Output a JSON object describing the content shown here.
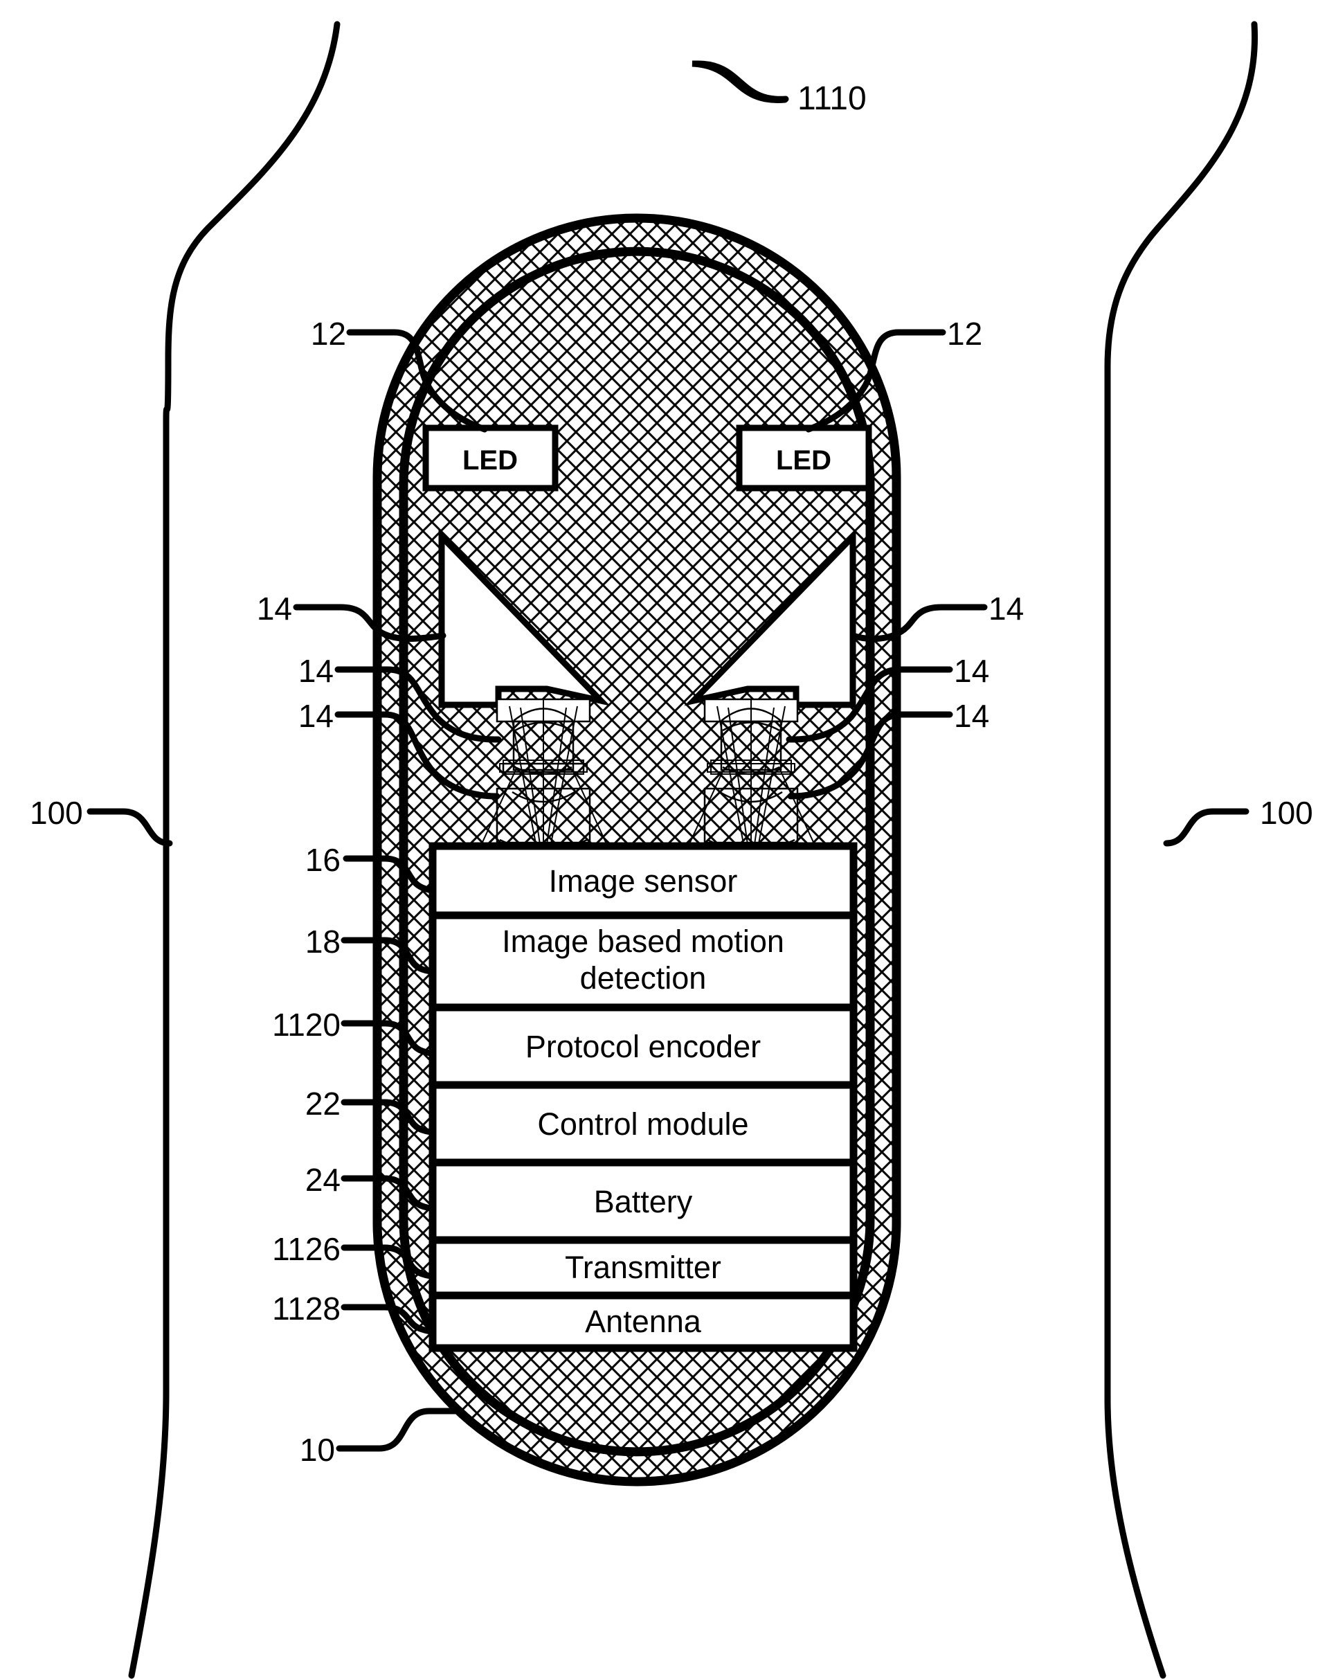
{
  "figure": {
    "kind": "patent-figure",
    "title_ref": "1110",
    "background_color": "#ffffff",
    "line_color": "#000000"
  },
  "body_outline": {
    "label_left": "100",
    "label_right": "100",
    "name": "patient-body-silhouette"
  },
  "capsule": {
    "shell_label": "10",
    "shell_description": "capsule-endoscope-shell",
    "window_label_left": "12",
    "window_label_right": "12"
  },
  "leds": [
    {
      "label": "LED",
      "ref": "12",
      "side": "left"
    },
    {
      "label": "LED",
      "ref": "12",
      "side": "right"
    }
  ],
  "optics_refs": {
    "left": [
      "14",
      "14",
      "14"
    ],
    "right": [
      "14",
      "14",
      "14"
    ]
  },
  "modules": [
    {
      "ref": "16",
      "label": "Image sensor"
    },
    {
      "ref": "18",
      "label": "Image based motion detection",
      "line1": "Image based motion",
      "line2": "detection"
    },
    {
      "ref": "1120",
      "label": "Protocol encoder"
    },
    {
      "ref": "22",
      "label": "Control module"
    },
    {
      "ref": "24",
      "label": "Battery"
    },
    {
      "ref": "1126",
      "label": "Transmitter"
    },
    {
      "ref": "1128",
      "label": "Antenna"
    }
  ]
}
